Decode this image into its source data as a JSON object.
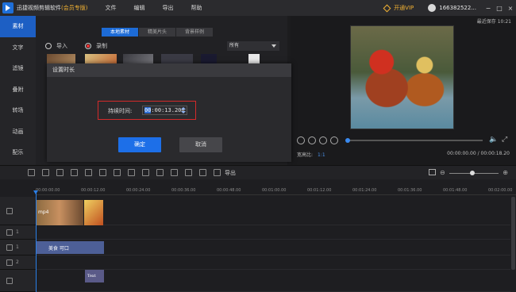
{
  "app": {
    "title": "迅捷视频剪辑软件",
    "edition": "(会员专版)",
    "menu": [
      "文件",
      "编辑",
      "导出",
      "帮助"
    ],
    "vip_button": "开通VIP",
    "user_id": "166382522...",
    "window_controls": [
      "−",
      "□",
      "×"
    ]
  },
  "sidebar": {
    "items": [
      {
        "label": "素材",
        "active": true
      },
      {
        "label": "文字",
        "active": false
      },
      {
        "label": "滤镜",
        "active": false
      },
      {
        "label": "叠附",
        "active": false
      },
      {
        "label": "转场",
        "active": false
      },
      {
        "label": "动画",
        "active": false
      },
      {
        "label": "配乐",
        "active": false
      }
    ]
  },
  "media": {
    "tabs": [
      {
        "label": "本地素材",
        "active": true
      },
      {
        "label": "精美片头",
        "active": false
      },
      {
        "label": "背景样例",
        "active": false
      }
    ],
    "import_label": "导入",
    "record_label": "录制",
    "filter_value": "所有"
  },
  "dialog": {
    "title": "设置时长",
    "duration_label": "持续时间:",
    "duration_selected": "00",
    "duration_rest": ":00:13.200",
    "ok_label": "确定",
    "cancel_label": "取消"
  },
  "preview": {
    "last_saved": "最近保存 10:21",
    "aspect_label": "宽高比:",
    "aspect_value": "1:1",
    "time_readout": "00:00:00.00 / 00:00:18.20",
    "progress": 0.0
  },
  "toolbar": {
    "export_label": "导出"
  },
  "timeline": {
    "ruler": [
      "00:00:00.00",
      "00:00:12.00",
      "00:00:24.00",
      "00:00:36.00",
      "00:00:48.00",
      "00:01:00.00",
      "00:01:12.00",
      "00:01:24.00",
      "00:01:36.00",
      "00:01:48.00",
      "00:02:00.00"
    ],
    "track_numbers": [
      "1",
      "1",
      "2"
    ],
    "clips": {
      "video_label": "mp4",
      "text1_label": "美食 可口",
      "text2_label": "Text"
    }
  },
  "colors": {
    "accent": "#1d6fe8",
    "highlight_border": "#d42a2a",
    "vip_gold": "#f2b233"
  }
}
